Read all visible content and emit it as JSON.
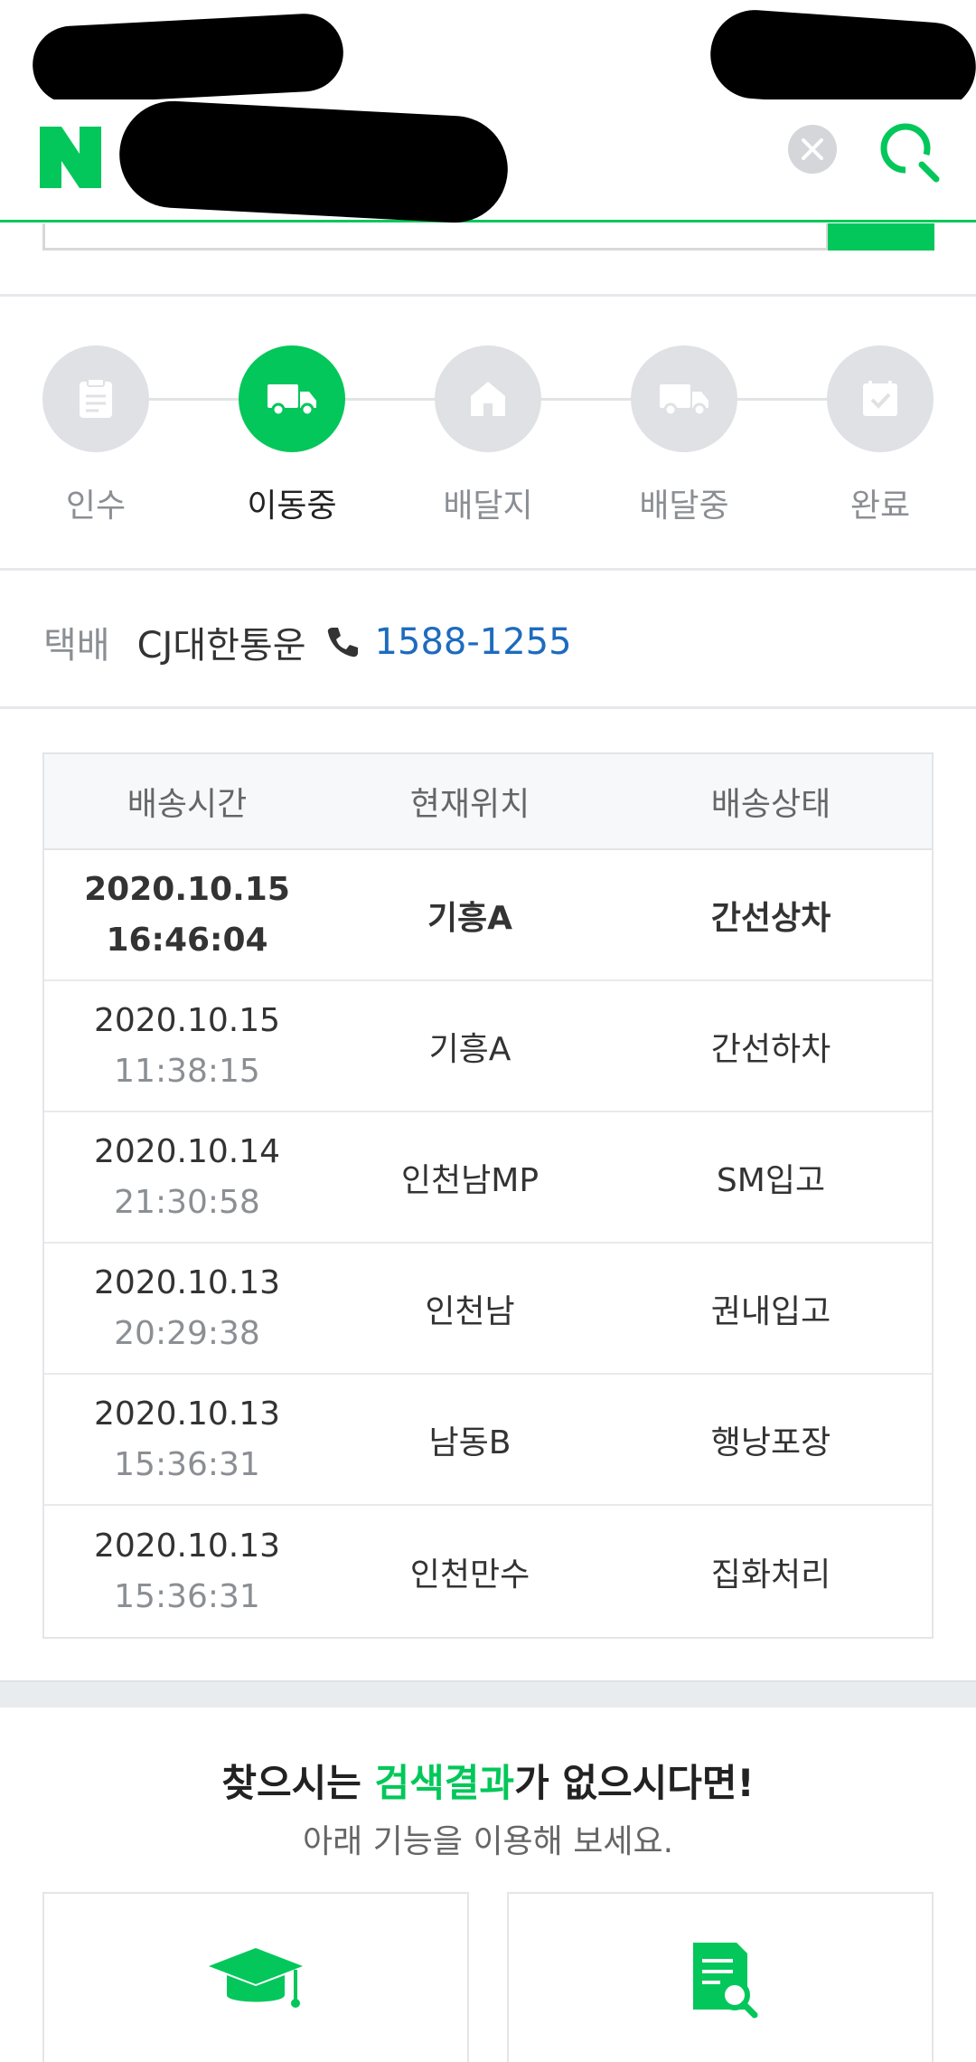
{
  "progress": {
    "steps": [
      {
        "label": "인수",
        "icon": "receipt-icon",
        "active": false
      },
      {
        "label": "이동중",
        "icon": "truck-icon",
        "active": true
      },
      {
        "label": "배달지",
        "icon": "house-icon",
        "active": false
      },
      {
        "label": "배달중",
        "icon": "truck-icon",
        "active": false
      },
      {
        "label": "완료",
        "icon": "check-icon",
        "active": false
      }
    ]
  },
  "courier": {
    "label": "택배",
    "name": "CJ대한통운",
    "phone": "1588-1255"
  },
  "tracking": {
    "headers": [
      "배송시간",
      "현재위치",
      "배송상태"
    ],
    "rows": [
      {
        "date": "2020.10.15",
        "time": "16:46:04",
        "location": "기흥A",
        "status": "간선상차"
      },
      {
        "date": "2020.10.15",
        "time": "11:38:15",
        "location": "기흥A",
        "status": "간선하차"
      },
      {
        "date": "2020.10.14",
        "time": "21:30:58",
        "location": "인천남MP",
        "status": "SM입고"
      },
      {
        "date": "2020.10.13",
        "time": "20:29:38",
        "location": "인천남",
        "status": "권내입고"
      },
      {
        "date": "2020.10.13",
        "time": "15:36:31",
        "location": "남동B",
        "status": "행낭포장"
      },
      {
        "date": "2020.10.13",
        "time": "15:36:31",
        "location": "인천만수",
        "status": "집화처리"
      }
    ]
  },
  "not_found": {
    "title_pre": "찾으시는 ",
    "title_highlight": "검색결과",
    "title_post": "가 없으시다면!",
    "subtitle": "아래 기능을 이용해 보세요."
  },
  "colors": {
    "brand": "#03c75a",
    "phone_link": "#1e6bbf",
    "inactive_step": "#dfe1e4"
  }
}
